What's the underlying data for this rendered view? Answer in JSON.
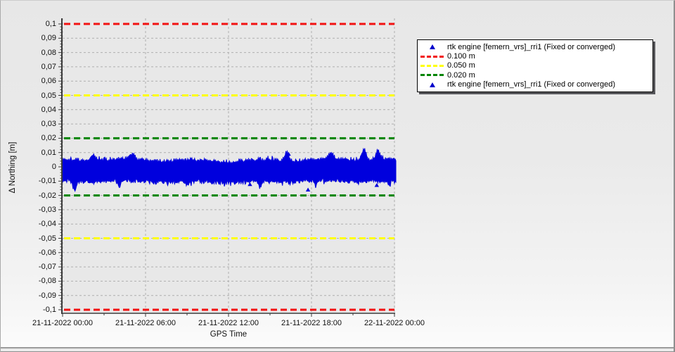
{
  "colors": {
    "marker_blue": "#0000dd",
    "legend_triangle_blue": "#0000cc",
    "ref_red": "#f21212",
    "ref_yellow": "#ffff00",
    "ref_green": "#008500",
    "grid_gray": "#aeaeae",
    "axis_dark": "#3c3c3c",
    "plot_bg": "#e8e8e8",
    "legend_bg": "#ffffff",
    "legend_border": "#000000"
  },
  "legend": {
    "entries": [
      {
        "marker": "triangle",
        "color": "#0000cc",
        "label": "rtk engine [femern_vrs]_rri1 (Fixed or converged)"
      },
      {
        "marker": "dashes",
        "color": "#f21212",
        "label": "0.100 m"
      },
      {
        "marker": "dashes",
        "color": "#ffff00",
        "label": "0.050 m"
      },
      {
        "marker": "dashes",
        "color": "#008500",
        "label": "0.020 m"
      },
      {
        "marker": "triangle",
        "color": "#0000cc",
        "label": "rtk engine [femern_vrs]_rri1 (Fixed or converged)"
      }
    ]
  },
  "chart_data": {
    "type": "scatter",
    "title": "",
    "xlabel": "GPS Time",
    "ylabel": "Δ Northing [m]",
    "ylim": [
      -0.104,
      0.104
    ],
    "y_tick_step": 0.01,
    "y_tick_labels": [
      "0,1",
      "0,09",
      "0,08",
      "0,07",
      "0,06",
      "0,05",
      "0,04",
      "0,03",
      "0,02",
      "0,01",
      "0",
      "-0,01",
      "-0,02",
      "-0,03",
      "-0,04",
      "-0,05",
      "-0,06",
      "-0,07",
      "-0,08",
      "-0,09",
      "-0,1"
    ],
    "x_tick_interval_hours": 6,
    "x_minor_tick_interval_hours": 3,
    "x_tick_labels": [
      "21-11-2022 00:00",
      "21-11-2022 06:00",
      "21-11-2022 12:00",
      "21-11-2022 18:00",
      "22-11-2022 00:00"
    ],
    "x_range_hours": [
      0,
      24
    ],
    "grid": true,
    "legend_position": "outside-top-right",
    "reference_lines": [
      {
        "label": "0.100 m",
        "value": 0.1,
        "mirrored": true,
        "color": "#f21212",
        "style": "dashed"
      },
      {
        "label": "0.050 m",
        "value": 0.05,
        "mirrored": true,
        "color": "#ffff00",
        "style": "dashed"
      },
      {
        "label": "0.020 m",
        "value": 0.02,
        "mirrored": true,
        "color": "#008500",
        "style": "dashed"
      }
    ],
    "series": [
      {
        "name": "rtk engine [femern_vrs]_rri1 (Fixed or converged)",
        "marker": "triangle",
        "color": "#0000dd",
        "description": "dense scatter band of RTK northing residuals over 24 h",
        "band": {
          "start_hour": 0.0,
          "end_hour": 24.15,
          "top_mean": 0.0032,
          "bottom_mean": -0.0086,
          "noise_amp": 0.0022,
          "seed": 1337,
          "spikes_up": [
            {
              "hour": 2.2,
              "value": 0.0075
            },
            {
              "hour": 5.0,
              "value": 0.007
            },
            {
              "hour": 16.2,
              "value": 0.0095
            },
            {
              "hour": 19.4,
              "value": 0.008
            },
            {
              "hour": 21.8,
              "value": 0.0118
            },
            {
              "hour": 22.8,
              "value": 0.0098
            }
          ],
          "dips_down": [
            {
              "hour": 0.85,
              "value": -0.0155
            },
            {
              "hour": 4.1,
              "value": -0.0126
            },
            {
              "hour": 9.0,
              "value": -0.011
            },
            {
              "hour": 14.3,
              "value": -0.0125
            },
            {
              "hour": 18.3,
              "value": -0.012
            },
            {
              "hour": 23.6,
              "value": -0.0115
            }
          ]
        },
        "outlier_points": [
          {
            "hour": 17.75,
            "value": -0.016
          },
          {
            "hour": 16.35,
            "value": 0.009
          },
          {
            "hour": 13.55,
            "value": -0.0122
          },
          {
            "hour": 22.72,
            "value": -0.0128
          }
        ]
      },
      {
        "name": "rtk engine [femern_vrs]_rri1 (Fixed or converged)",
        "marker": "triangle",
        "color": "#0000dd",
        "description": "duplicate legend entry of same series"
      }
    ]
  }
}
